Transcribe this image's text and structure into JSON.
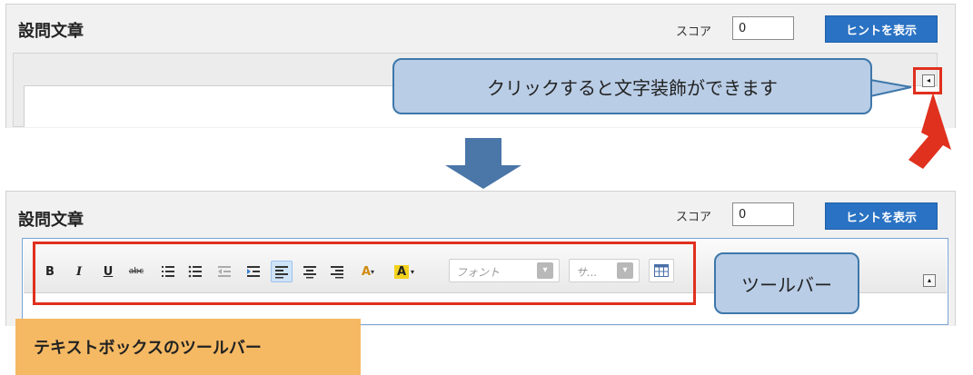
{
  "top": {
    "title": "設問文章",
    "score_label": "スコア",
    "score_value": "0",
    "hint_button": "ヒントを表示",
    "callout_text": "クリックすると文字装飾ができます",
    "collapse_icon": "◂"
  },
  "bottom": {
    "title": "設問文章",
    "score_label": "スコア",
    "score_value": "0",
    "hint_button": "ヒントを表示",
    "callout_text": "ツールバー",
    "collapse_icon": "▴",
    "font_placeholder": "フォント",
    "size_placeholder": "サ...",
    "dropdown_arrow": "▾"
  },
  "toolbar": {
    "bold": "B",
    "italic": "I",
    "underline": "U",
    "strike": "abc",
    "font_color": "A",
    "bg_color": "A"
  },
  "caption": "テキストボックスのツールバー",
  "colors": {
    "accent_red": "#e0301e",
    "hint_button": "#2a72c3",
    "callout_fill": "#b9cde6",
    "caption_fill": "#f5b963",
    "arrow_blue": "#4a76a8"
  }
}
